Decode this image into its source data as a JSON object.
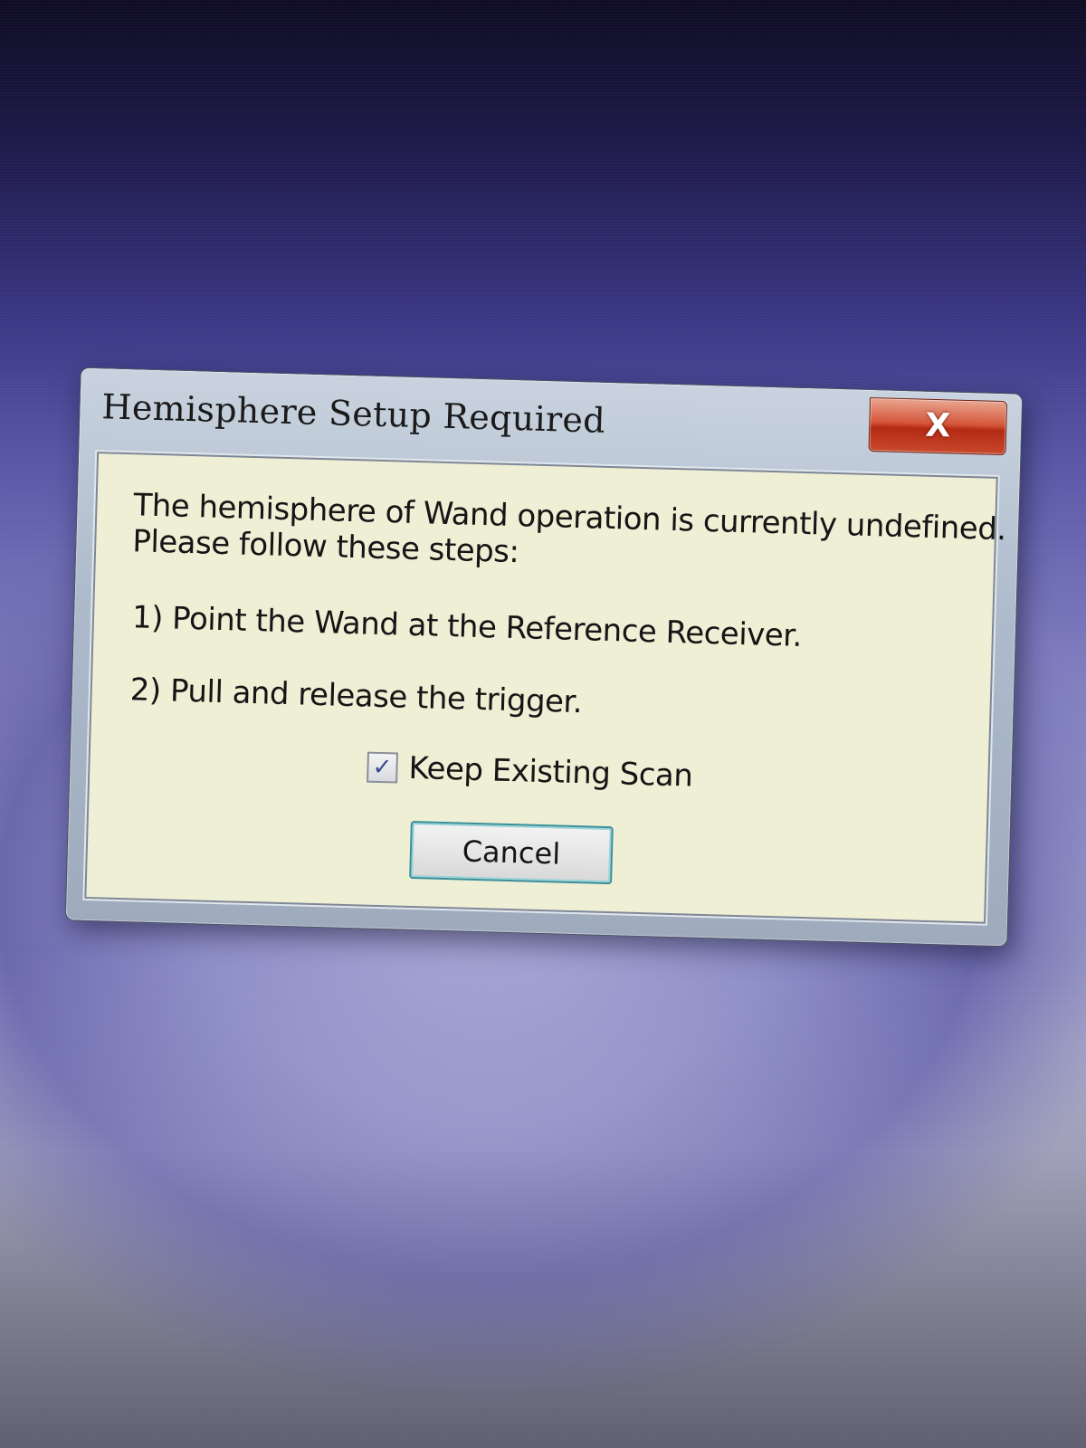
{
  "dialog": {
    "title": "Hemisphere Setup Required",
    "close_icon": "close-icon",
    "close_glyph": "X",
    "message_line_1": "The hemisphere of Wand operation is currently undefined.",
    "message_line_2": "Please follow these steps:",
    "step_1": "1) Point the Wand at the Reference Receiver.",
    "step_2": "2) Pull and release the trigger.",
    "checkbox": {
      "label": "Keep Existing Scan",
      "checked": true,
      "icon": "checkmark-icon",
      "glyph": "✓"
    },
    "cancel_label": "Cancel"
  },
  "colors": {
    "client_background": "#efefd6",
    "close_button": "#c9482c",
    "focus_border": "#3a8f9a"
  }
}
